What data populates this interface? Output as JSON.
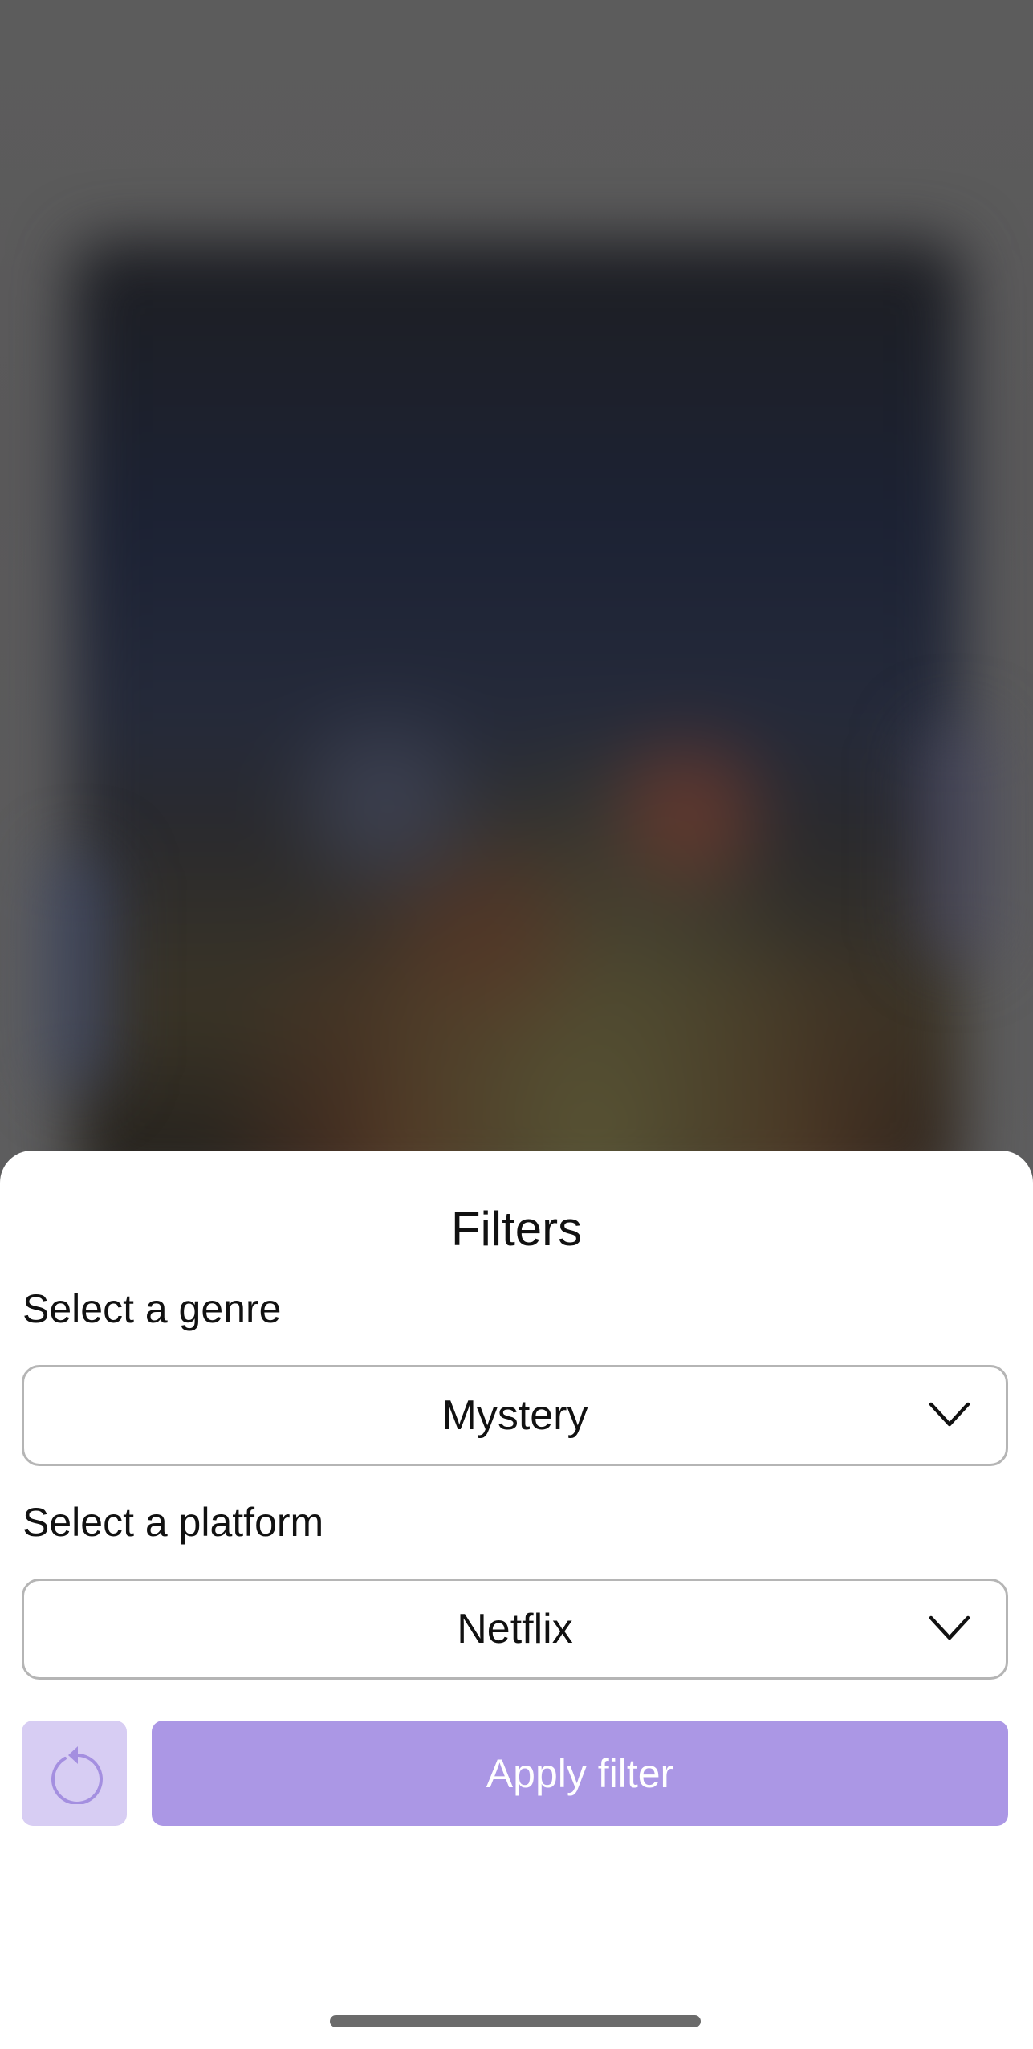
{
  "sheet": {
    "title": "Filters"
  },
  "genre": {
    "label": "Select a genre",
    "selected": "Mystery"
  },
  "platform": {
    "label": "Select a platform",
    "selected": "Netflix"
  },
  "actions": {
    "reset_icon": "reset-icon",
    "apply_label": "Apply filter"
  },
  "colors": {
    "accent": "#ab97e5",
    "accent_light": "#d7cdf3",
    "icon_accent": "#a48fe0"
  }
}
